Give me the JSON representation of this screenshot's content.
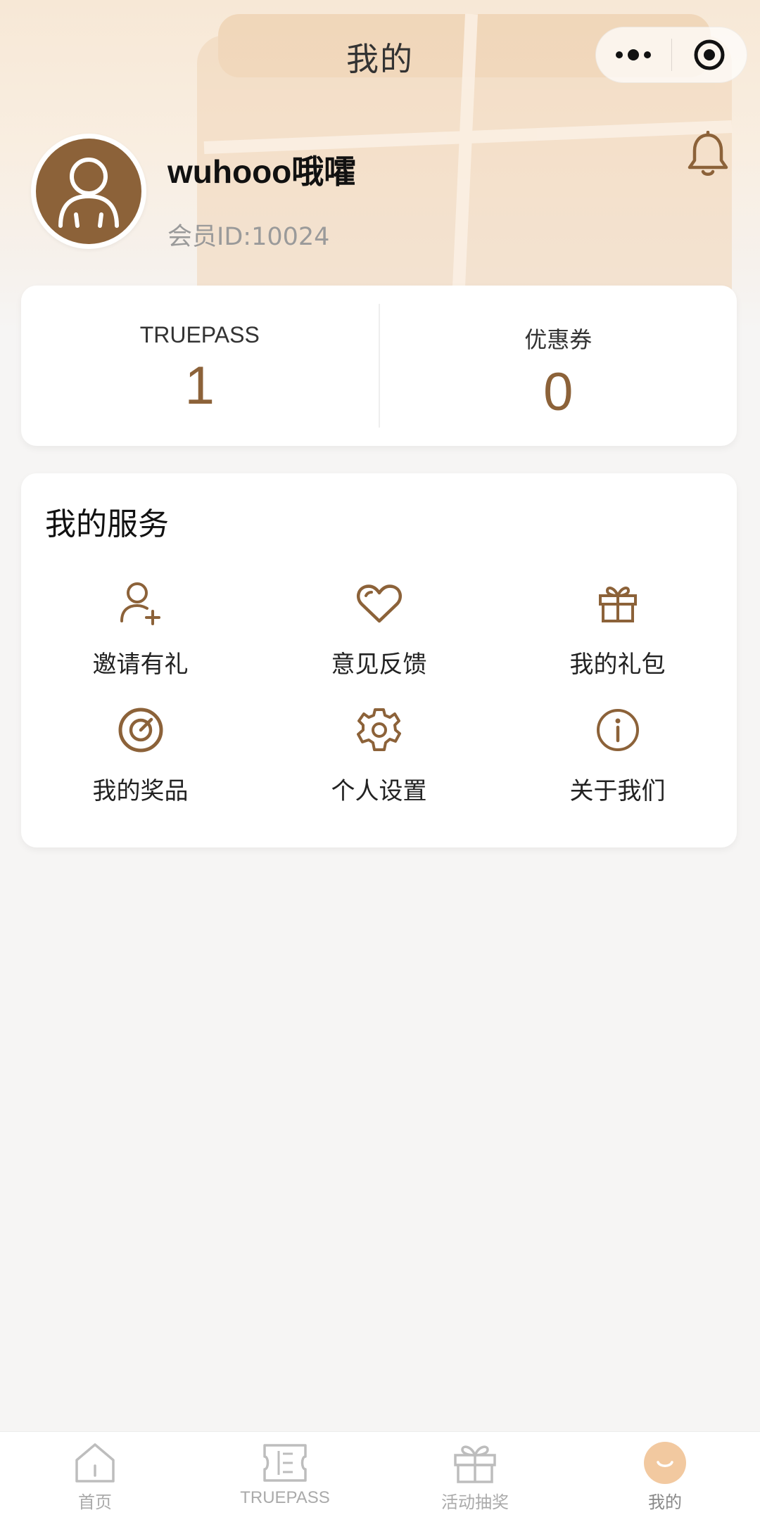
{
  "nav": {
    "title": "我的"
  },
  "profile": {
    "username": "wuhooo哦嚯",
    "member_id": "会员ID:10024"
  },
  "stats": [
    {
      "label": "TRUEPASS",
      "value": "1"
    },
    {
      "label": "优惠券",
      "value": "0"
    }
  ],
  "services": {
    "title": "我的服务",
    "items": [
      {
        "label": "邀请有礼",
        "icon": "add-user-icon"
      },
      {
        "label": "意见反馈",
        "icon": "heart-icon"
      },
      {
        "label": "我的礼包",
        "icon": "gift-icon"
      },
      {
        "label": "我的奖品",
        "icon": "target-icon"
      },
      {
        "label": "个人设置",
        "icon": "gear-icon"
      },
      {
        "label": "关于我们",
        "icon": "info-icon"
      }
    ]
  },
  "tabbar": [
    {
      "label": "首页",
      "icon": "home-icon",
      "active": false
    },
    {
      "label": "TRUEPASS",
      "icon": "ticket-icon",
      "active": false
    },
    {
      "label": "活动抽奖",
      "icon": "gift-icon",
      "active": false
    },
    {
      "label": "我的",
      "icon": "smile-icon",
      "active": true
    }
  ],
  "colors": {
    "accent": "#8c6239",
    "tab_active": "#f2c9a0",
    "background": "#f6f5f4"
  }
}
